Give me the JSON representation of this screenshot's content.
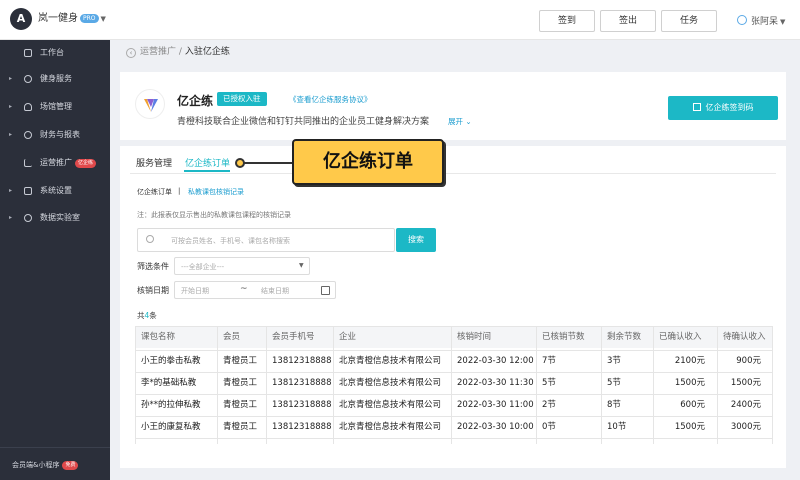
{
  "topbar": {
    "app_name": "岚一健身",
    "badge": "PRO",
    "buttons": [
      "签到",
      "签出",
      "任务"
    ],
    "user": "张阿呆"
  },
  "sidebar": {
    "items": [
      {
        "label": "工作台",
        "arrow": ""
      },
      {
        "label": "健身服务",
        "arrow": "▸"
      },
      {
        "label": "场馆管理",
        "arrow": "▸"
      },
      {
        "label": "财务与报表",
        "arrow": "▸"
      },
      {
        "label": "运营推广",
        "arrow": "",
        "badge": "亿企练"
      },
      {
        "label": "系统设置",
        "arrow": "▸"
      },
      {
        "label": "数据实验室",
        "arrow": "▸"
      }
    ],
    "bottom_label": "会员端&小程序",
    "bottom_badge": "免费"
  },
  "breadcrumb": {
    "parent": "运营推广",
    "separator": "/",
    "current": "入驻亿企练"
  },
  "header": {
    "title": "亿企练",
    "auth_badge": "已授权入驻",
    "agreement_link": "《查看亿企练服务协议》",
    "description": "青橙科技联合企业微信和钉钉共同推出的企业员工健身解决方案",
    "expand": "展开",
    "qr_button": "亿企练签到码"
  },
  "tabs": {
    "items": [
      "服务管理",
      "亿企练订单"
    ]
  },
  "subtabs": {
    "items": [
      "亿企练订单",
      "私教课包核销记录"
    ],
    "separator": "|"
  },
  "filters": {
    "note": "注：此报表仅显示售出的私教课包课程的核销记录",
    "search_placeholder": "可按会员姓名、手机号、课包名称搜索",
    "search_button": "搜索",
    "condition_label": "筛选条件",
    "condition_placeholder": "---全部企业---",
    "date_label": "核销日期",
    "date_start": "开始日期",
    "date_tilde": "~",
    "date_end": "结束日期"
  },
  "total": {
    "prefix": "共",
    "count": "4",
    "suffix": "条"
  },
  "table": {
    "headers": [
      "课包名称",
      "会员",
      "会员手机号",
      "企业",
      "核销时间",
      "已核销节数",
      "剩余节数",
      "已确认收入",
      "待确认收入"
    ],
    "rows": [
      [
        "小王的拳击私教",
        "青橙员工",
        "13812318888",
        "北京青橙信息技术有限公司",
        "2022-03-30 12:00",
        "7节",
        "3节",
        "2100元",
        "900元"
      ],
      [
        "李*的基础私教",
        "青橙员工",
        "13812318888",
        "北京青橙信息技术有限公司",
        "2022-03-30 11:30",
        "5节",
        "5节",
        "1500元",
        "1500元"
      ],
      [
        "孙**的拉伸私教",
        "青橙员工",
        "13812318888",
        "北京青橙信息技术有限公司",
        "2022-03-30 11:00",
        "2节",
        "8节",
        "600元",
        "2400元"
      ],
      [
        "小王的康复私教",
        "青橙员工",
        "13812318888",
        "北京青橙信息技术有限公司",
        "2022-03-30 10:00",
        "0节",
        "10节",
        "1500元",
        "3000元"
      ]
    ]
  },
  "callout": {
    "text": "亿企练订单"
  },
  "colors": {
    "accent": "#1cb8c6",
    "sidebar": "#2b2f3a",
    "callout": "#ffc94a"
  }
}
